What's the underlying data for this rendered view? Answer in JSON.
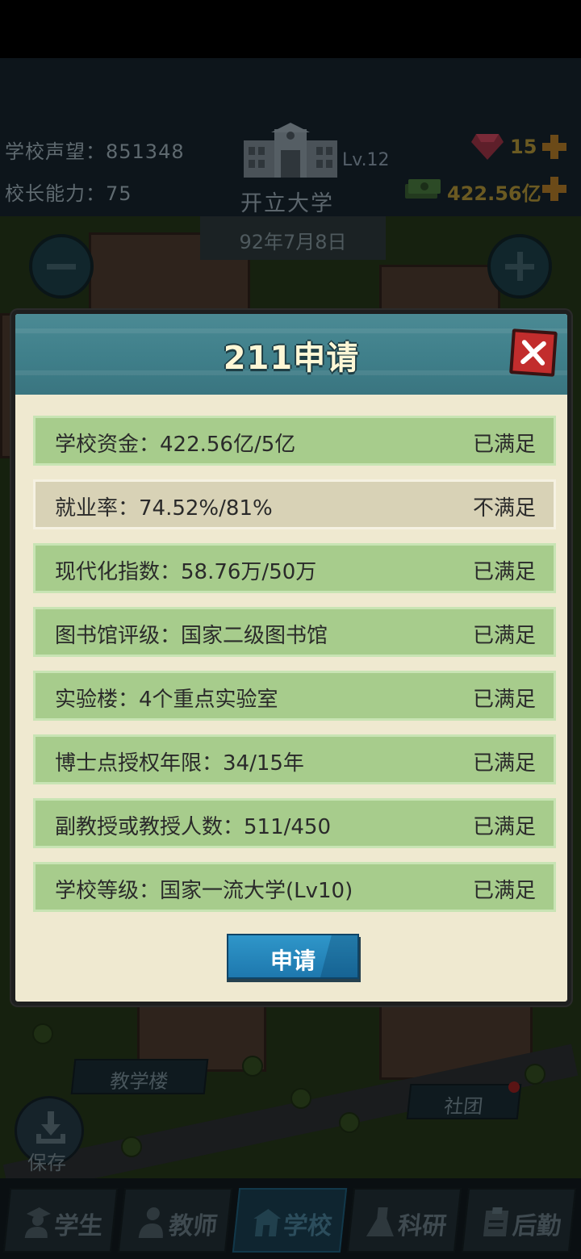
{
  "header": {
    "reputation_label": "学校声望：",
    "reputation_value": "851348",
    "ability_label": "校长能力：",
    "ability_value": "75",
    "school_level": "Lv.12",
    "school_name": "开立大学",
    "gems": "15",
    "money": "422.56亿"
  },
  "map": {
    "date": "92年7月8日",
    "labels": {
      "teaching_building": "教学楼",
      "club": "社团"
    },
    "save_label": "保存"
  },
  "dialog": {
    "title": "211申请",
    "requirements": [
      {
        "text": "学校资金：422.56亿/5亿",
        "status": "已满足"
      },
      {
        "text": "就业率：74.52%/81%",
        "status": "不满足"
      },
      {
        "text": "现代化指数：58.76万/50万",
        "status": "已满足"
      },
      {
        "text": "图书馆评级：国家二级图书馆",
        "status": "已满足"
      },
      {
        "text": "实验楼：4个重点实验室",
        "status": "已满足"
      },
      {
        "text": "博士点授权年限：34/15年",
        "status": "已满足"
      },
      {
        "text": "副教授或教授人数：511/450",
        "status": "已满足"
      },
      {
        "text": "学校等级：国家一流大学(Lv10)",
        "status": "已满足"
      }
    ],
    "apply_label": "申请"
  },
  "nav": {
    "tabs": [
      {
        "label": "学生",
        "icon": "student-icon"
      },
      {
        "label": "教师",
        "icon": "teacher-icon"
      },
      {
        "label": "学校",
        "icon": "school-icon"
      },
      {
        "label": "科研",
        "icon": "flask-icon"
      },
      {
        "label": "后勤",
        "icon": "clipboard-icon"
      }
    ],
    "active": "学校"
  },
  "colors": {
    "met_row": "#a7cc8c",
    "unmet_row": "#d8d2b6",
    "dialog_bg": "#efe9d0",
    "header_teal": "#3f7f8a",
    "close_red": "#c22d2d",
    "apply_blue": "#1e78ae"
  }
}
